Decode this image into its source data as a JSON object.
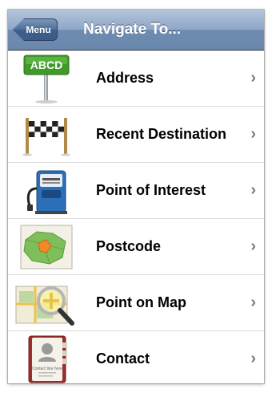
{
  "navbar": {
    "back_label": "Menu",
    "title": "Navigate To..."
  },
  "items": [
    {
      "label": "Address",
      "icon": "address-sign-icon",
      "icon_text": "ABCD"
    },
    {
      "label": "Recent Destination",
      "icon": "checkered-flag-icon"
    },
    {
      "label": "Point of Interest",
      "icon": "fuel-pump-icon"
    },
    {
      "label": "Postcode",
      "icon": "postcode-map-icon"
    },
    {
      "label": "Point on Map",
      "icon": "magnifier-map-icon"
    },
    {
      "label": "Contact",
      "icon": "address-book-icon",
      "icon_text": "Contact line here"
    }
  ],
  "chevron": "›",
  "colors": {
    "navbar": "#7a95b8",
    "sign_green": "#3f9a2a",
    "map_green": "#7fbf5a"
  }
}
